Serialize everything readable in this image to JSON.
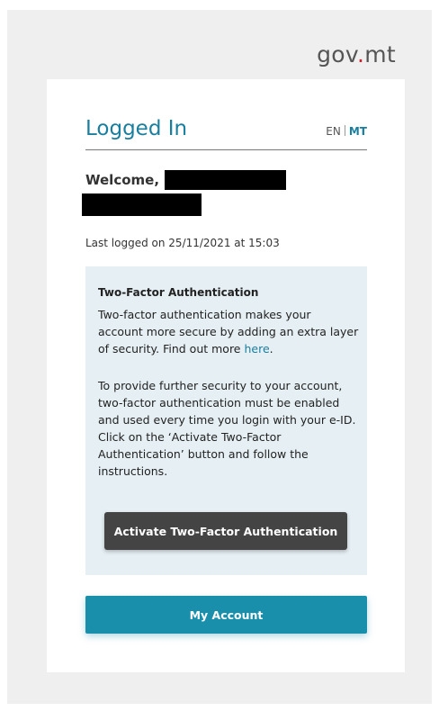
{
  "logo": {
    "pre": "gov",
    "dot": ".",
    "post": "mt"
  },
  "header": {
    "title": "Logged In",
    "lang_en": "EN",
    "lang_mt": "MT"
  },
  "welcome": {
    "label": "Welcome,"
  },
  "last_logged": "Last logged on 25/11/2021 at 15:03",
  "tfa": {
    "title": "Two-Factor Authentication",
    "p1_text": "Two-factor authentication makes your account more secure by adding an extra layer of security. Find out more ",
    "p1_link": "here",
    "p1_end": ".",
    "p2": "To provide further security to your account, two-factor authentication must be enabled and used every time you login with your e-ID. Click on the ‘Activate Two-Factor Authentication’ button and follow the instructions.",
    "button": "Activate Two-Factor Authentication"
  },
  "account_button": "My Account",
  "colors": {
    "accent": "#1a7e9e",
    "button_primary": "#1a8fac",
    "button_dark": "#444444",
    "panel_bg": "#e6f0f4",
    "logo_dot": "#d0202f"
  }
}
